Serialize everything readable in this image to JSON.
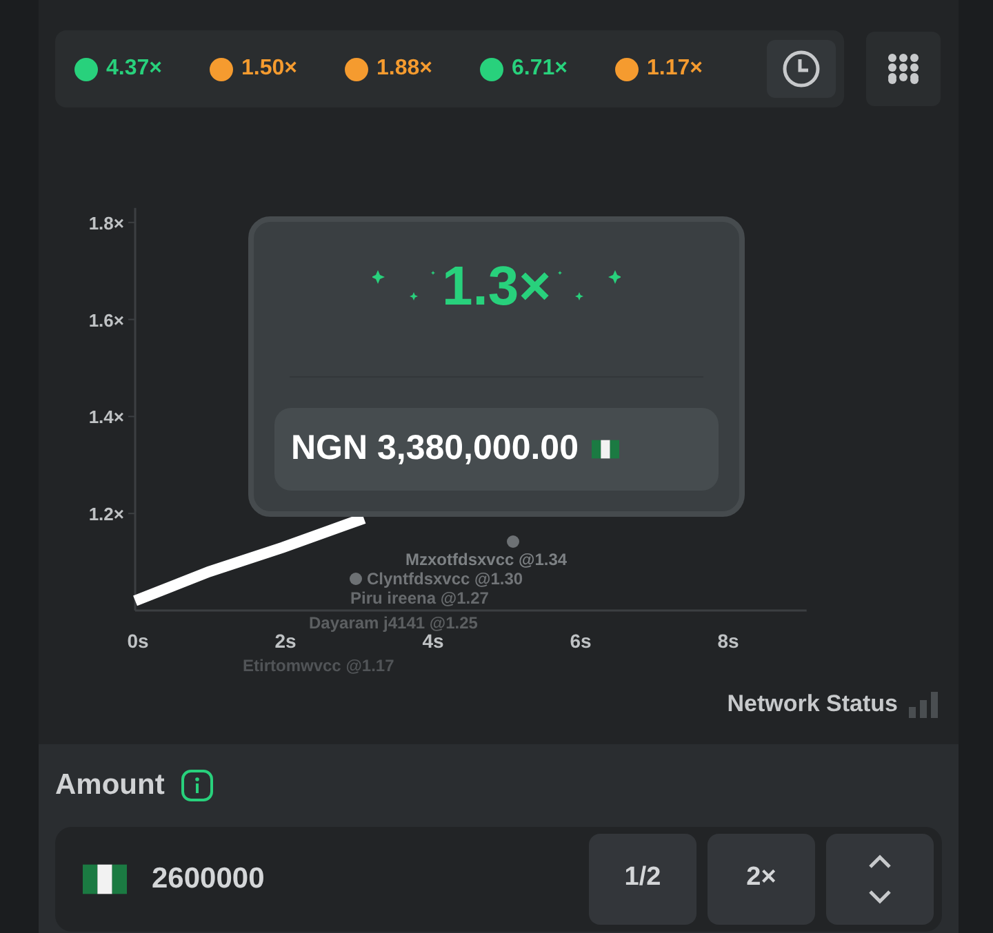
{
  "history": [
    {
      "value": "4.37×",
      "color": "#28d17c"
    },
    {
      "value": "1.50×",
      "color": "#f59b2f"
    },
    {
      "value": "1.88×",
      "color": "#f59b2f"
    },
    {
      "value": "6.71×",
      "color": "#28d17c"
    },
    {
      "value": "1.17×",
      "color": "#f59b2f"
    }
  ],
  "chart": {
    "chart_data": {
      "type": "line",
      "x": [
        0,
        1,
        2,
        3.1
      ],
      "series": [
        {
          "color": "#ffffff",
          "values": [
            1.02,
            1.08,
            1.13,
            1.19
          ]
        }
      ],
      "xlim": [
        0,
        9.1
      ],
      "ylim": [
        1.0,
        1.83
      ],
      "xticks": [
        {
          "value": 0,
          "label": "0s"
        },
        {
          "value": 2,
          "label": "2s"
        },
        {
          "value": 4,
          "label": "4s"
        },
        {
          "value": 6,
          "label": "6s"
        },
        {
          "value": 8,
          "label": "8s"
        }
      ],
      "yticks": [
        {
          "value": 1.2,
          "label": "1.2×"
        },
        {
          "value": 1.4,
          "label": "1.4×"
        },
        {
          "value": 1.6,
          "label": "1.6×"
        },
        {
          "value": 1.8,
          "label": "1.8×"
        }
      ]
    },
    "players": [
      {
        "label": "Mzxotfdsxvcc @1.34"
      },
      {
        "label": "Clyntfdsxvcc @1.30"
      },
      {
        "label": "Piru ireena @1.27"
      },
      {
        "label": "Dayaram j4141 @1.25"
      },
      {
        "label": "Etirtomwvcc @1.17"
      }
    ]
  },
  "multiplier_card": {
    "multiplier": "1.3×",
    "payout": "NGN 3,380,000.00"
  },
  "network_status": "Network Status",
  "amount": {
    "label": "Amount",
    "value": "2600000",
    "buttons": [
      "1/2",
      "2×"
    ]
  }
}
